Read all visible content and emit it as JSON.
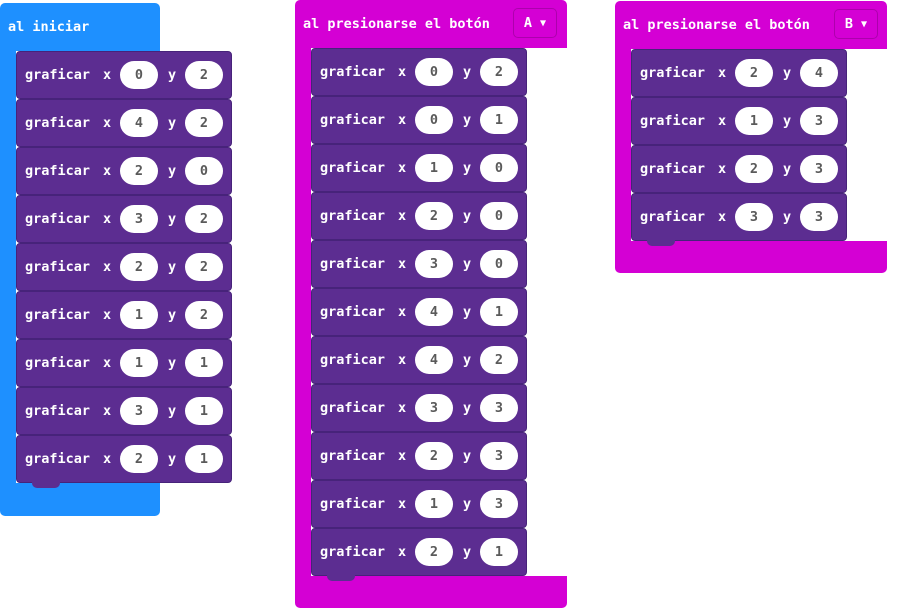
{
  "blocks": {
    "start": {
      "label": "al iniciar"
    },
    "buttonA": {
      "label": "al presionarse el botón",
      "button": "A",
      "caret": "▼"
    },
    "buttonB": {
      "label": "al presionarse el botón",
      "button": "B",
      "caret": "▼"
    }
  },
  "plot_label": "graficar",
  "x_label": "x",
  "y_label": "y",
  "stacks": {
    "start": [
      {
        "x": "0",
        "y": "2"
      },
      {
        "x": "4",
        "y": "2"
      },
      {
        "x": "2",
        "y": "0"
      },
      {
        "x": "3",
        "y": "2"
      },
      {
        "x": "2",
        "y": "2"
      },
      {
        "x": "1",
        "y": "2"
      },
      {
        "x": "1",
        "y": "1"
      },
      {
        "x": "3",
        "y": "1"
      },
      {
        "x": "2",
        "y": "1"
      }
    ],
    "buttonA": [
      {
        "x": "0",
        "y": "2"
      },
      {
        "x": "0",
        "y": "1"
      },
      {
        "x": "1",
        "y": "0"
      },
      {
        "x": "2",
        "y": "0"
      },
      {
        "x": "3",
        "y": "0"
      },
      {
        "x": "4",
        "y": "1"
      },
      {
        "x": "4",
        "y": "2"
      },
      {
        "x": "3",
        "y": "3"
      },
      {
        "x": "2",
        "y": "3"
      },
      {
        "x": "1",
        "y": "3"
      },
      {
        "x": "2",
        "y": "1"
      }
    ],
    "buttonB": [
      {
        "x": "2",
        "y": "4"
      },
      {
        "x": "1",
        "y": "3"
      },
      {
        "x": "2",
        "y": "3"
      },
      {
        "x": "3",
        "y": "3"
      }
    ]
  },
  "colors": {
    "start": "#1e90ff",
    "button": "#d400d4",
    "plot": "#5c2d91"
  }
}
